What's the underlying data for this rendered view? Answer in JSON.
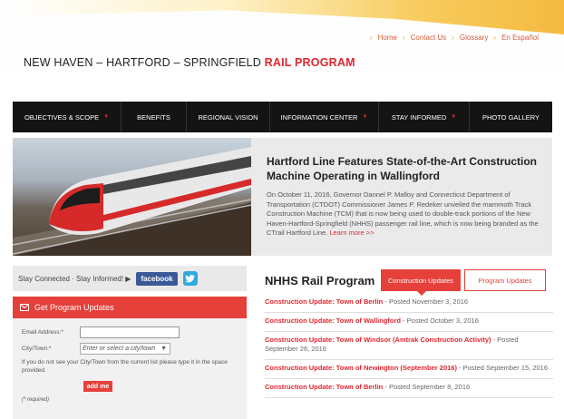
{
  "utility_links": [
    "Home",
    "Contact Us",
    "Glossary",
    "En Español"
  ],
  "logo": {
    "main": "NEW HAVEN – HARTFORD – SPRINGFIELD ",
    "accent": "RAIL PROGRAM"
  },
  "nav": [
    {
      "label": "OBJECTIVES & SCOPE",
      "dropdown": true
    },
    {
      "label": "BENEFITS",
      "dropdown": false
    },
    {
      "label": "REGIONAL VISION",
      "dropdown": false
    },
    {
      "label": "INFORMATION CENTER",
      "dropdown": true
    },
    {
      "label": "STAY INFORMED",
      "dropdown": true
    },
    {
      "label": "PHOTO GALLERY",
      "dropdown": false
    }
  ],
  "hero": {
    "title": "Hartford Line Features State-of-the-Art Construction Machine Operating in Wallingford",
    "body": "On October 11, 2016, Governor Dannel P. Malloy and Connecticut Department of Transportation (CTDOT) Commissioner James P. Redeker unveiled the mammoth Track Construction Machine (TCM) that is now being used to double-track portions of the New Haven-Hartford-Springfield (NHHS) passenger rail line, which is now being branded as the CTrail Hartford Line.",
    "more": "Learn more >>"
  },
  "connect": {
    "text": "Stay Connected · Stay Informed! ▶",
    "facebook": "facebook"
  },
  "signup": {
    "title": "Get Program Updates",
    "email_label": "Email Address:*",
    "city_label": "City/Town:*",
    "city_placeholder": "Enter or select a city/town",
    "note": "If you do not see your City/Town from the current list please type it in the space provided.",
    "button": "add me",
    "required": "(* required)"
  },
  "rail": {
    "title": "NHHS Rail Program",
    "tabs": [
      "Construction Updates",
      "Program Updates"
    ],
    "updates": [
      {
        "title": "Construction Update: Town of Berlin",
        "posted": " - Posted November 3, 2016"
      },
      {
        "title": "Construction Update: Town of Wallingford",
        "posted": " - Posted October 3, 2016"
      },
      {
        "title": "Construction Update: Town of Windsor (Amtrak Construction Activity)",
        "posted": " - Posted September 26, 2016"
      },
      {
        "title": "Construction Update: Town of Newington (September 2016)",
        "posted": " - Posted September 15, 2016"
      },
      {
        "title": "Construction Update: Town of Berlin",
        "posted": " - Posted September 8, 2016"
      }
    ]
  },
  "colors": {
    "accent": "#e5403a",
    "nav_bg": "#141414",
    "link": "#e2262f"
  }
}
